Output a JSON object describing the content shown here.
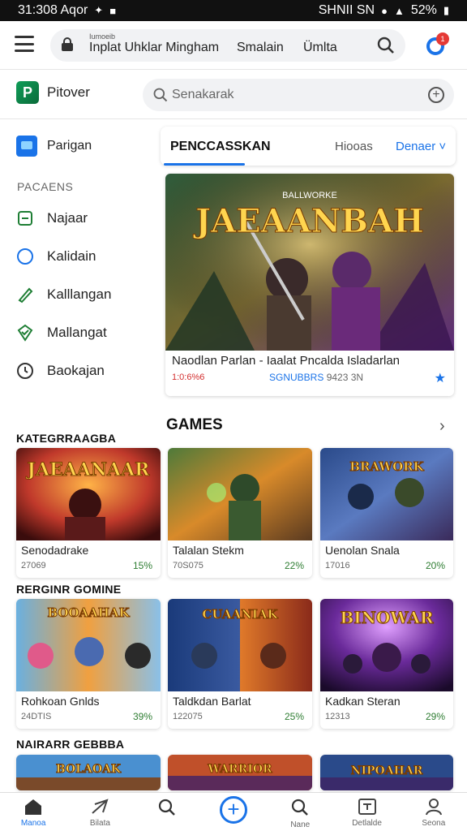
{
  "status_bar": {
    "time": "31:308 Aqor",
    "carrier": "SHNII SN",
    "battery": "52%"
  },
  "browser": {
    "url_small": "Iumoeib",
    "url_text_1": "Inplat Uhklar Mingham",
    "url_text_2": "Smalain",
    "url_text_3": "Ümlta",
    "notification_count": "1"
  },
  "app": {
    "brand": "Pitover",
    "search_placeholder": "Senakarak"
  },
  "sidebar": {
    "top_item": "Parigan",
    "section_label": "PACAENS",
    "items": [
      {
        "label": "Najaar",
        "icon": "square-minus-icon"
      },
      {
        "label": "Kalidain",
        "icon": "circle-icon"
      },
      {
        "label": "Kalllangan",
        "icon": "pencil-icon"
      },
      {
        "label": "Mallangat",
        "icon": "shield-check-icon"
      },
      {
        "label": "Baokajan",
        "icon": "clock-icon"
      }
    ]
  },
  "tabs": {
    "active": "PENCCASSKAN",
    "second": "Hiooas",
    "third": "Denaer"
  },
  "featured": {
    "art_title": "JAEAANBAH",
    "art_subtitle": "BALLWORKE",
    "title": "Naodlan Parlan - Iaalat Pncalda Isladarlan",
    "price": "1:0:6%6",
    "meta_label": "SGNUBBRS",
    "meta_count": "9423 3N"
  },
  "games_heading": "GAMES",
  "sections": [
    {
      "heading": "KATEGRRAAGBA",
      "cards": [
        {
          "art_title": "JAEAANAAR",
          "name": "Senodadrake",
          "num": "27069",
          "pct": "15%"
        },
        {
          "art_title": "",
          "name": "Talalan Stekm",
          "num": "70S075",
          "pct": "22%"
        },
        {
          "art_title": "BRAWORK",
          "name": "Uenolan Snala",
          "num": "17016",
          "pct": "20%"
        }
      ]
    },
    {
      "heading": "RERGINR GOMINE",
      "cards": [
        {
          "art_title": "BOOAAHAK",
          "name": "Rohkoan Gnlds",
          "num": "24DTIS",
          "pct": "39%"
        },
        {
          "art_title": "CUAANIAK",
          "name": "Taldkdan Barlat",
          "num": "122075",
          "pct": "25%"
        },
        {
          "art_title": "BINOWAR",
          "name": "Kadkan Steran",
          "num": "12313",
          "pct": "29%"
        }
      ]
    },
    {
      "heading": "NAIRARR GEBBBA",
      "cards": [
        {
          "art_title": "BOLAOAK"
        },
        {
          "art_title": "WARRIOR"
        },
        {
          "art_title": "NIPOAHAR"
        }
      ]
    }
  ],
  "bottom_nav": [
    {
      "label": "Manoa",
      "icon": "home-icon"
    },
    {
      "label": "Bilata",
      "icon": "send-icon"
    },
    {
      "label": "",
      "icon": "search-icon"
    },
    {
      "label": "",
      "icon": "plus-circle-icon"
    },
    {
      "label": "Nane",
      "icon": "search-icon"
    },
    {
      "label": "Detlalde",
      "icon": "trending-icon"
    },
    {
      "label": "Seona",
      "icon": "profile-icon"
    }
  ],
  "colors": {
    "accent": "#1a73e8",
    "percent": "#2e7d32",
    "price": "#d32f2f",
    "notification": "#e53935"
  }
}
